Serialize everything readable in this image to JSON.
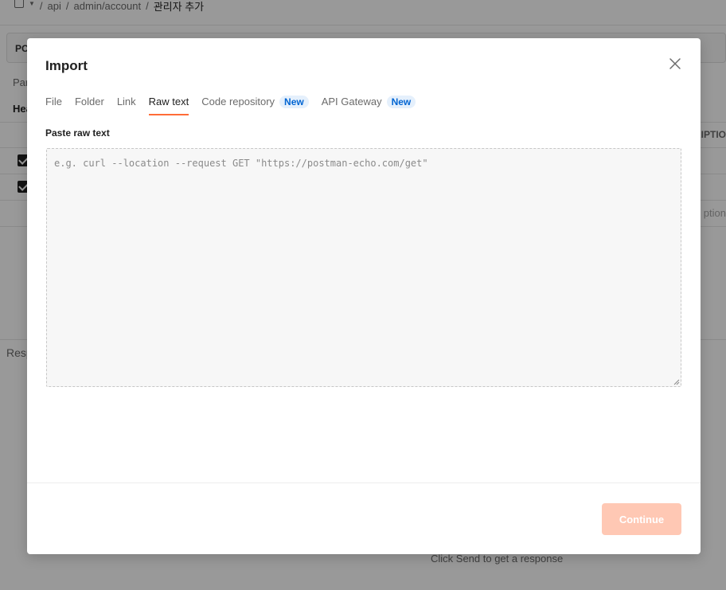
{
  "background": {
    "breadcrumb": {
      "segments": [
        "api",
        "admin/account"
      ],
      "current": "관리자 추가"
    },
    "request_method": "PO",
    "params_tab": "Par",
    "headers_tab": "Hea",
    "description_header": "RIPTIO",
    "description_placeholder": "ption",
    "response_label": "Resp",
    "send_hint": "Click Send to get a response"
  },
  "modal": {
    "title": "Import",
    "tabs": [
      {
        "label": "File",
        "active": false
      },
      {
        "label": "Folder",
        "active": false
      },
      {
        "label": "Link",
        "active": false
      },
      {
        "label": "Raw text",
        "active": true
      },
      {
        "label": "Code repository",
        "active": false,
        "badge": "New"
      },
      {
        "label": "API Gateway",
        "active": false,
        "badge": "New"
      }
    ],
    "raw_text": {
      "label": "Paste raw text",
      "value": "",
      "placeholder": "e.g. curl --location --request GET \"https://postman-echo.com/get\""
    },
    "continue_label": "Continue",
    "continue_disabled": true
  },
  "colors": {
    "accent": "#ff6c37",
    "continue_disabled_bg": "#ffc8b4",
    "badge_bg": "#e5f0fc",
    "badge_text": "#0265d2",
    "overlay": "rgba(0,0,0,0.40)"
  },
  "icons": {
    "close": "close-icon",
    "document": "document-icon",
    "dropdown": "caret-down-icon",
    "resize": "resize-grip-icon"
  }
}
